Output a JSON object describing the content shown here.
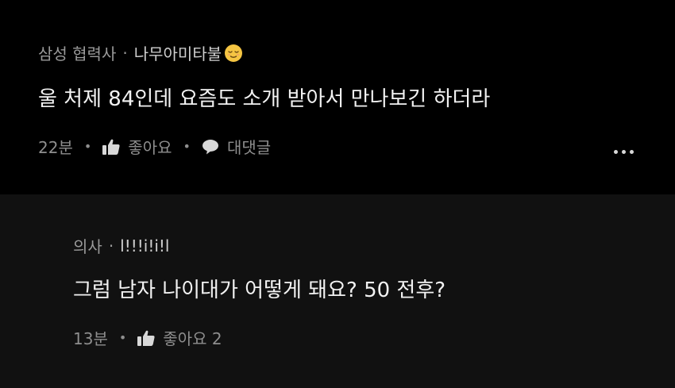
{
  "comments": [
    {
      "company": "삼성 협력사",
      "separator": "·",
      "nickname": "나무아미타불",
      "emoji_icon": "relieved-face-emoji",
      "text": "울 처제 84인데 요즘도 소개 받아서 만나보긴 하더라",
      "time": "22분",
      "like_label": "좋아요",
      "reply_label": "대댓글",
      "more_icon": "more-options-icon"
    },
    {
      "company": "의사",
      "separator": "·",
      "nickname": "l!!!i!i!l",
      "text": "그럼 남자 나이대가 어떻게 돼요? 50 전후?",
      "time": "13분",
      "like_label": "좋아요 2"
    }
  ],
  "colors": {
    "background_top": "#000000",
    "background_reply": "#111111",
    "text_primary": "#f2f2f2",
    "text_secondary": "#8e8e8e",
    "emoji": "#f5c542"
  }
}
